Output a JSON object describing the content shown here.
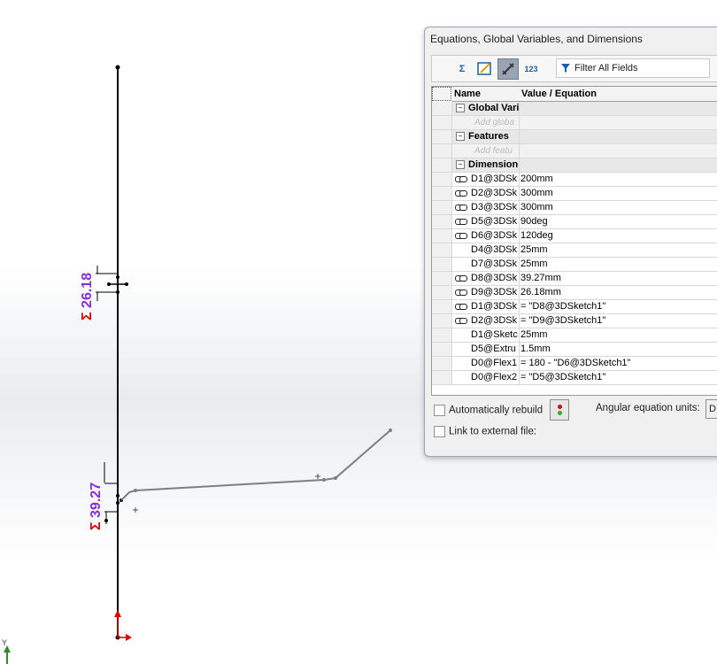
{
  "dialog": {
    "title": "Equations, Global Variables, and Dimensions",
    "toolbar": {
      "buttons": [
        {
          "icon": "equation-view-icon",
          "label": "Σ"
        },
        {
          "icon": "sketch-equation-view-icon",
          "label": ""
        },
        {
          "icon": "dimension-view-icon",
          "label": ""
        },
        {
          "icon": "ordered-view-icon",
          "label": "123"
        }
      ],
      "filter_label": "Filter All Fields"
    },
    "columns": {
      "name": "Name",
      "value": "Value / Equation"
    },
    "groups": {
      "global": {
        "label": "Global Vari",
        "add_placeholder": "Add globa"
      },
      "features": {
        "label": "Features",
        "add_placeholder": "Add featu"
      },
      "dimensions": {
        "label": "Dimension"
      }
    },
    "rows": [
      {
        "name": "D1@3DSk",
        "value": "200mm",
        "linked": true
      },
      {
        "name": "D2@3DSk",
        "value": "300mm",
        "linked": true
      },
      {
        "name": "D3@3DSk",
        "value": "300mm",
        "linked": true
      },
      {
        "name": "D5@3DSk",
        "value": "90deg",
        "linked": true
      },
      {
        "name": "D6@3DSk",
        "value": "120deg",
        "linked": true
      },
      {
        "name": "D4@3DSk",
        "value": "25mm",
        "linked": false
      },
      {
        "name": "D7@3DSk",
        "value": "25mm",
        "linked": false
      },
      {
        "name": "D8@3DSk",
        "value": "39.27mm",
        "linked": true
      },
      {
        "name": "D9@3DSk",
        "value": "26.18mm",
        "linked": true
      },
      {
        "name": "D1@3DSk",
        "value": "= \"D8@3DSketch1\"",
        "linked": true
      },
      {
        "name": "D2@3DSk",
        "value": "= \"D9@3DSketch1\"",
        "linked": true
      },
      {
        "name": "D1@Sketc",
        "value": "25mm",
        "linked": false
      },
      {
        "name": "D5@Extru",
        "value": "1.5mm",
        "linked": false
      },
      {
        "name": "D0@Flex1",
        "value": "= 180 - \"D6@3DSketch1\"",
        "linked": false
      },
      {
        "name": "D0@Flex2",
        "value": "= \"D5@3DSketch1\"",
        "linked": false
      }
    ],
    "bottom": {
      "auto_rebuild": "Automatically rebuild",
      "link_external": "Link to external file:",
      "angular_units": "Angular equation units:",
      "angular_value": "D"
    }
  },
  "sketch": {
    "dim_upper": {
      "symbol": "Σ",
      "value": "26.18"
    },
    "dim_lower": {
      "symbol": "Σ",
      "value": "39.27"
    },
    "axis_label": "Y",
    "colors": {
      "sigma": "#e00000",
      "value": "#8a2be2",
      "line": "#000000",
      "path": "#7f7f7f",
      "axis": "#e00000"
    }
  }
}
